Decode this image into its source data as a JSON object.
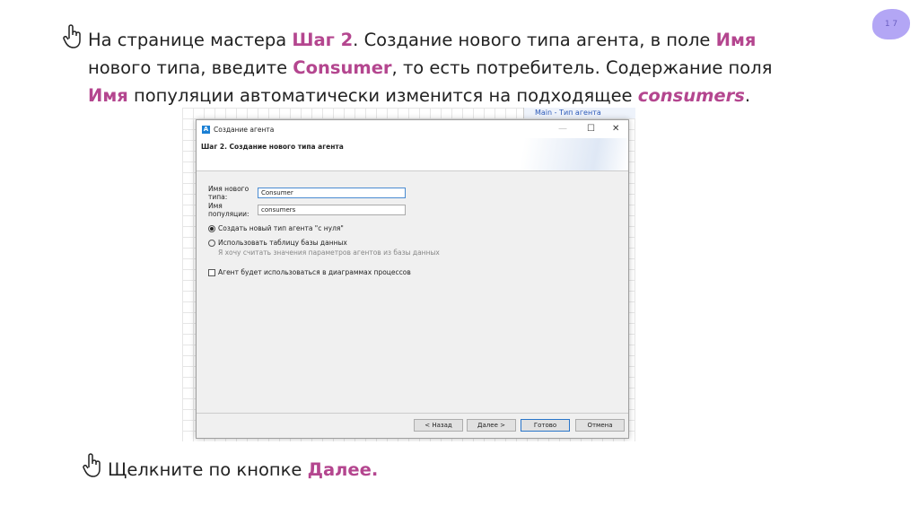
{
  "slide_number": "1 7",
  "instruction1": {
    "p1": "На странице мастера ",
    "b1": "Шаг 2",
    "p2": ". Создание нового типа агента, в поле ",
    "b2": "Имя",
    "p3": "нового типа, введите ",
    "b3": "Consumer",
    "p4": ", то есть потребитель. Содержание поля",
    "b4": "Имя",
    "p5": " популяции автоматически изменится на подходящее ",
    "b5": "consumers",
    "p6": "."
  },
  "instruction2": {
    "p1": "Щелкните по кнопке ",
    "b1": "Далее."
  },
  "accent_color": "#b4468f",
  "background_tab": "Main - Тип агента",
  "dialog": {
    "title": "Создание агента",
    "step_title": "Шаг 2. Создание нового типа агента",
    "type_name_label": "Имя нового типа:",
    "type_name_value": "Consumer",
    "population_label": "Имя популяции:",
    "population_value": "consumers",
    "radio_new": "Создать новый тип агента \"с нуля\"",
    "radio_db": "Использовать таблицу базы данных",
    "radio_db_hint": "Я хочу считать значения параметров агентов из базы данных",
    "checkbox_process": "Агент будет использоваться в диаграммах процессов",
    "buttons": {
      "back": "< Назад",
      "next": "Далее >",
      "finish": "Готово",
      "cancel": "Отмена"
    }
  }
}
